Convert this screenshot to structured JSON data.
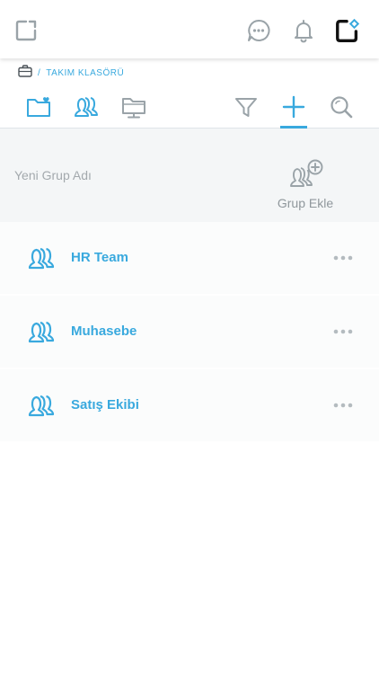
{
  "header": {
    "icons": [
      "brand-logo-icon",
      "chat-icon",
      "bell-icon",
      "profile-logo-icon"
    ]
  },
  "breadcrumb": {
    "separator": "/",
    "label": "TAKIM KLASÖRÜ"
  },
  "toolbar": {
    "left_tabs": [
      "favorite-folder-icon",
      "groups-icon",
      "screen-folder-icon"
    ],
    "right_tabs": [
      "filter-icon",
      "plus-icon",
      "search-icon"
    ],
    "active_tab": "plus-icon"
  },
  "add_group": {
    "placeholder": "Yeni Grup Adı",
    "button_label": "Grup Ekle"
  },
  "groups": [
    {
      "name": "HR Team"
    },
    {
      "name": "Muhasebe"
    },
    {
      "name": "Satış Ekibi"
    }
  ],
  "colors": {
    "accent": "#39a9de",
    "icon_gray": "#9aa3a8",
    "panel_bg": "#f4f6f7",
    "row_bg": "#fbfcfc"
  }
}
